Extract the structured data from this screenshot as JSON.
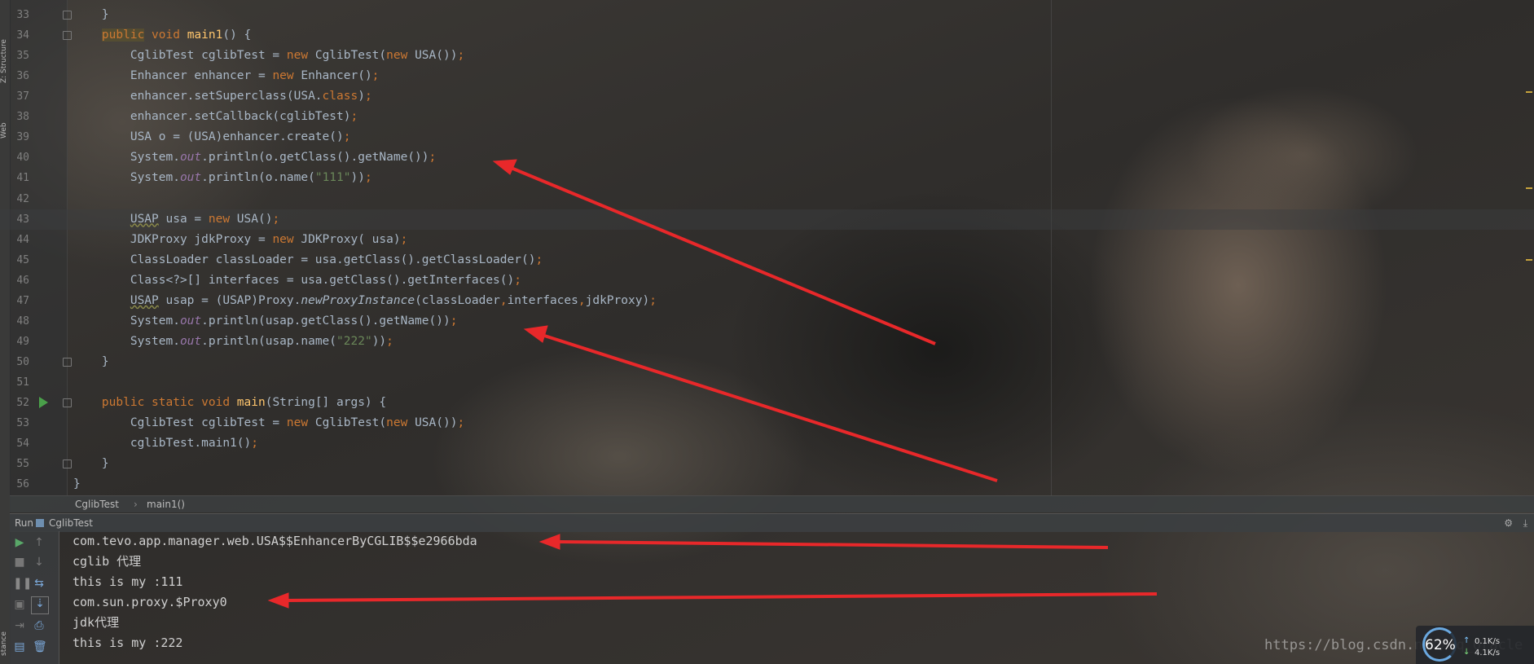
{
  "side_strip": {
    "structure_label": "Z: Structure",
    "web_label": "Web",
    "instance_label": "stance"
  },
  "code_lines": [
    {
      "num": "33",
      "html": "    }"
    },
    {
      "num": "34",
      "html": "    <span class=\"kw public-hl\">public</span> <span class=\"kw\">void</span> <span class=\"fn\">main1</span>() {"
    },
    {
      "num": "35",
      "html": "        CglibTest cglibTest = <span class=\"kw\">new</span> CglibTest(<span class=\"kw\">new</span> USA())<span class=\"kw\">;</span>"
    },
    {
      "num": "36",
      "html": "        Enhancer enhancer = <span class=\"kw\">new</span> Enhancer()<span class=\"kw\">;</span>"
    },
    {
      "num": "37",
      "html": "        enhancer.setSuperclass(USA.<span class=\"kw\">class</span>)<span class=\"kw\">;</span>"
    },
    {
      "num": "38",
      "html": "        enhancer.setCallback(cglibTest)<span class=\"kw\">;</span>"
    },
    {
      "num": "39",
      "html": "        USA o = (USA)enhancer.create()<span class=\"kw\">;</span>"
    },
    {
      "num": "40",
      "html": "        System.<span class=\"st\">out</span>.println(o.getClass().getName())<span class=\"kw\">;</span>"
    },
    {
      "num": "41",
      "html": "        System.<span class=\"st\">out</span>.println(o.name(<span class=\"str\">\"111\"</span>))<span class=\"kw\">;</span>"
    },
    {
      "num": "42",
      "html": ""
    },
    {
      "num": "43",
      "html": "        <span class=\"warn\">USAP</span> usa = <span class=\"kw\">new</span> USA()<span class=\"kw\">;</span>"
    },
    {
      "num": "44",
      "html": "        JDKProxy jdkProxy = <span class=\"kw\">new</span> JDKProxy( usa)<span class=\"kw\">;</span>"
    },
    {
      "num": "45",
      "html": "        ClassLoader classLoader = usa.getClass().getClassLoader()<span class=\"kw\">;</span>"
    },
    {
      "num": "46",
      "html": "        Class&lt;?&gt;[] interfaces = usa.getClass().getInterfaces()<span class=\"kw\">;</span>"
    },
    {
      "num": "47",
      "html": "        <span class=\"warn\">USAP</span> usap = (USAP)Proxy.<span class=\"mi\">newProxyInstance</span>(classLoader<span class=\"kw\">,</span>interfaces<span class=\"kw\">,</span>jdkProxy)<span class=\"kw\">;</span>"
    },
    {
      "num": "48",
      "html": "        System.<span class=\"st\">out</span>.println(usap.getClass().getName())<span class=\"kw\">;</span>"
    },
    {
      "num": "49",
      "html": "        System.<span class=\"st\">out</span>.println(usap.name(<span class=\"str\">\"222\"</span>))<span class=\"kw\">;</span>"
    },
    {
      "num": "50",
      "html": "    }"
    },
    {
      "num": "51",
      "html": ""
    },
    {
      "num": "52",
      "html": "    <span class=\"kw\">public static void</span> <span class=\"fn\">main</span>(String[] args) {"
    },
    {
      "num": "53",
      "html": "        CglibTest cglibTest = <span class=\"kw\">new</span> CglibTest(<span class=\"kw\">new</span> USA())<span class=\"kw\">;</span>"
    },
    {
      "num": "54",
      "html": "        cglibTest.main1()<span class=\"kw\">;</span>"
    },
    {
      "num": "55",
      "html": "    }"
    },
    {
      "num": "56",
      "html": "}"
    }
  ],
  "breadcrumb": {
    "class_name": "CglibTest",
    "separator": "›",
    "method_name": "main1()"
  },
  "run_window": {
    "title": "Run",
    "config_name": "CglibTest"
  },
  "console_output": [
    "com.tevo.app.manager.web.USA$$EnhancerByCGLIB$$e2966bda",
    "cglib 代理",
    "this is my :111",
    "com.sun.proxy.$Proxy0",
    "jdk代理",
    "this is my :222"
  ],
  "watermark": "https://blog.csdn.net/qq_Oracle",
  "net_widget": {
    "cpu_percent": "62%",
    "upload": "0.1K/s",
    "download": "4.1K/s"
  },
  "colors": {
    "keyword": "#cc7832",
    "function": "#ffc66d",
    "string": "#6a8759",
    "static_field": "#9876aa",
    "arrow": "#e8282a"
  }
}
